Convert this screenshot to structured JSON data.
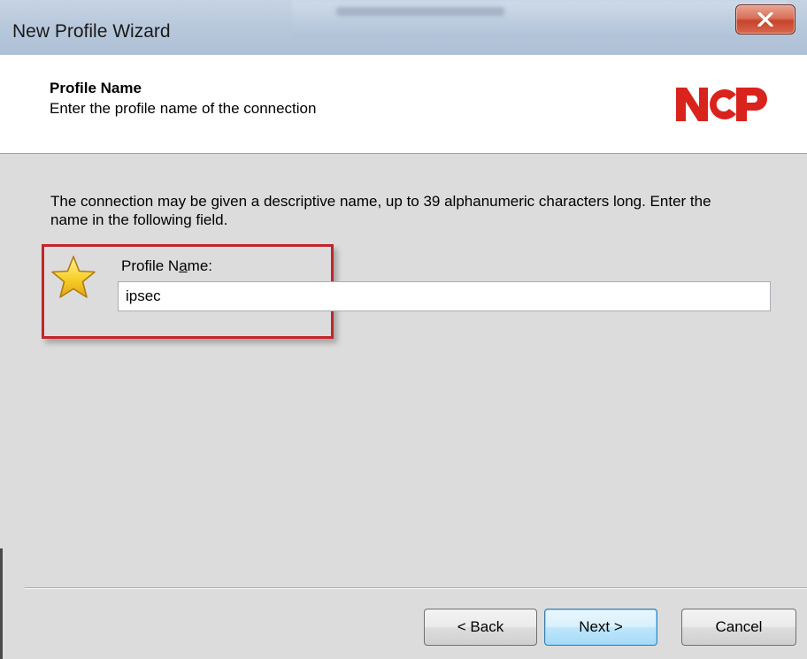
{
  "window": {
    "title": "New Profile Wizard",
    "close_label": "x"
  },
  "header": {
    "title": "Profile Name",
    "subtitle": "Enter the profile name of the connection",
    "logo_text": "NCP",
    "logo_color": "#d9231d"
  },
  "body": {
    "description": "The connection may be given a descriptive name, up to 39 alphanumeric characters long. Enter the name in the following field.",
    "field_label_prefix": "Profile N",
    "field_label_mnemonic": "a",
    "field_label_suffix": "me:",
    "field_icon": "star-icon",
    "profile_name_value": "ipsec",
    "highlight_color": "#c0262b"
  },
  "footer": {
    "back_label": "< Back",
    "next_label": "Next >",
    "cancel_label": "Cancel"
  }
}
